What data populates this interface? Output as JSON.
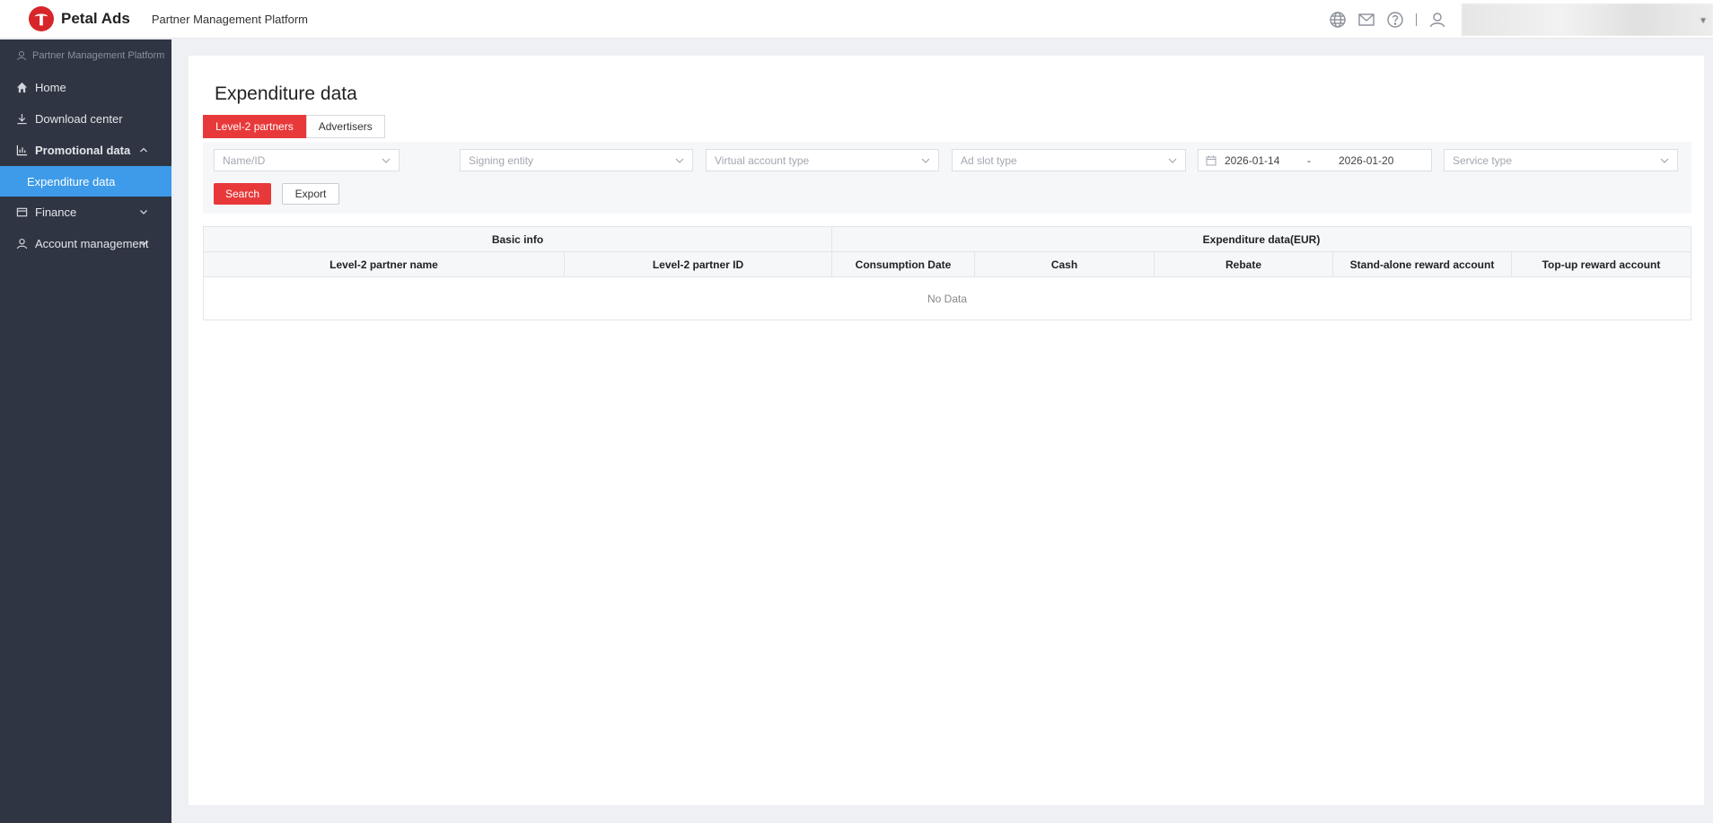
{
  "header": {
    "brand": "Petal Ads",
    "platform_title": "Partner Management Platform"
  },
  "sidebar": {
    "section_label": "Partner Management Platform",
    "items": [
      {
        "label": "Home",
        "icon": "home-icon"
      },
      {
        "label": "Download center",
        "icon": "download-icon"
      },
      {
        "label": "Promotional data",
        "icon": "chart-icon",
        "expanded": true
      },
      {
        "label": "Expenditure data",
        "active": true
      },
      {
        "label": "Finance",
        "icon": "wallet-icon"
      },
      {
        "label": "Account management",
        "icon": "user-icon"
      }
    ]
  },
  "main": {
    "title": "Expenditure data",
    "tabs": [
      {
        "label": "Level-2 partners",
        "active": true
      },
      {
        "label": "Advertisers",
        "active": false
      }
    ],
    "filters": {
      "name_id_placeholder": "Name/ID",
      "signing_entity_placeholder": "Signing entity",
      "virtual_account_type_placeholder": "Virtual account type",
      "ad_slot_type_placeholder": "Ad slot type",
      "date_start": "2026-01-14",
      "date_separator": "-",
      "date_end": "2026-01-20",
      "service_type_placeholder": "Service type"
    },
    "buttons": {
      "search": "Search",
      "export": "Export"
    },
    "table": {
      "group_headers": [
        "Basic info",
        "Expenditure data(EUR)"
      ],
      "columns": [
        "Level-2 partner name",
        "Level-2 partner ID",
        "Consumption Date",
        "Cash",
        "Rebate",
        "Stand-alone reward account",
        "Top-up reward account"
      ],
      "empty_text": "No Data"
    }
  },
  "colors": {
    "accent": "#e8393a",
    "sidebar_bg": "#2f3542",
    "sidebar_active": "#3d9be9"
  }
}
